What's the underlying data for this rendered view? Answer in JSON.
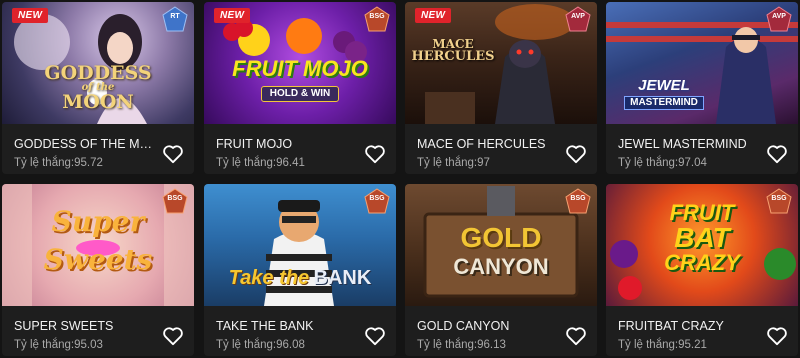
{
  "win_rate_label": "Tỷ lệ thắng:",
  "games": [
    {
      "name": "GODDESS OF THE MOO...",
      "rate": "95.72",
      "badge": "NEW",
      "provider": "RT",
      "art": [
        "GODDESS",
        "of the",
        "MOON"
      ]
    },
    {
      "name": "FRUIT MOJO",
      "rate": "96.41",
      "badge": "NEW",
      "provider": "BSG",
      "art": [
        "FRUIT MOJO",
        "HOLD & WIN"
      ]
    },
    {
      "name": "MACE OF HERCULES",
      "rate": "97",
      "badge": "NEW",
      "provider": "AVP",
      "art": [
        "MACE",
        "HERCULES"
      ]
    },
    {
      "name": "JEWEL MASTERMIND",
      "rate": "97.04",
      "badge": "",
      "provider": "AVP",
      "art": [
        "JEWEL",
        "MASTERMIND"
      ]
    },
    {
      "name": "SUPER SWEETS",
      "rate": "95.03",
      "badge": "",
      "provider": "BSG",
      "art": [
        "Super",
        "Sweets"
      ]
    },
    {
      "name": "TAKE THE BANK",
      "rate": "96.08",
      "badge": "",
      "provider": "BSG",
      "art": [
        "Take the",
        "BANK"
      ]
    },
    {
      "name": "GOLD CANYON",
      "rate": "96.13",
      "badge": "",
      "provider": "BSG",
      "art": [
        "GOLD",
        "CANYON"
      ]
    },
    {
      "name": "FRUITBAT CRAZY",
      "rate": "95.21",
      "badge": "",
      "provider": "BSG",
      "art": [
        "FRUIT",
        "BAT",
        "CRAZY"
      ]
    }
  ]
}
